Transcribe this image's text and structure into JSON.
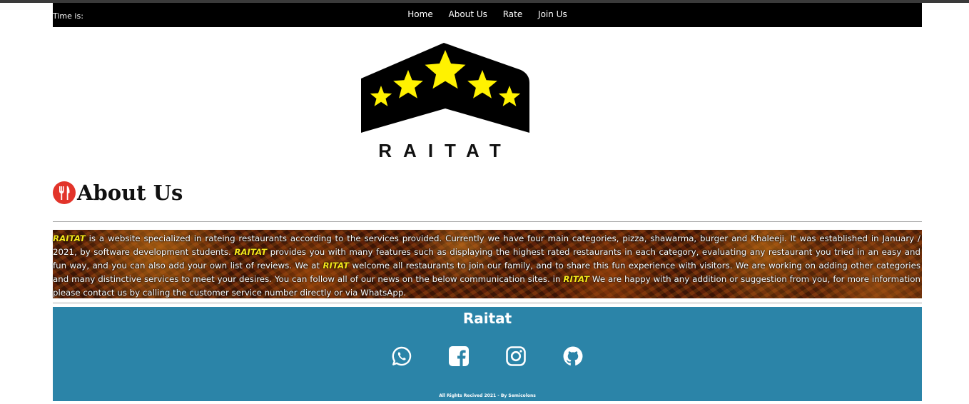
{
  "navbar": {
    "time_label": "Time is:",
    "links": [
      "Home",
      "About Us",
      "Rate",
      "Join Us"
    ]
  },
  "logo": {
    "text": "RAITAT",
    "star_color": "#FFF200",
    "badge_color": "#000000"
  },
  "section": {
    "title": "About Us",
    "icon": "fork-knife-icon",
    "icon_color": "#E2342A"
  },
  "about": {
    "brand_primary": "RAITAT",
    "brand_alt": "RITAT",
    "p1": " is a website specialized in rateing restaurants according to the services provided. Currently we have four main categories, pizza, shawarma, burger and Khaleeji. It was established in January / 2021, by software development students. ",
    "p2": " provides you with many features such as displaying the highest rated restaurants in each category, evaluating any restaurant you tried in an easy and fun way, and you can also add your own list of reviews. We at ",
    "p3": " welcome all restaurants to join our family, and to share this fun experience with visitors. We are working on adding other categories and many distinctive services to meet your desires. You can follow all of our news on the below communication sites. in ",
    "p4": " We are happy with any addition or suggestion from you, for more information please contact us by calling the customer service number directly or via WhatsApp."
  },
  "footer": {
    "title": "Raitat",
    "social_icons": [
      "whatsapp-icon",
      "facebook-icon",
      "instagram-icon",
      "github-icon"
    ],
    "copyright": "All Rights Recived 2021 - By Semicolons",
    "background": "#2B84A8"
  }
}
